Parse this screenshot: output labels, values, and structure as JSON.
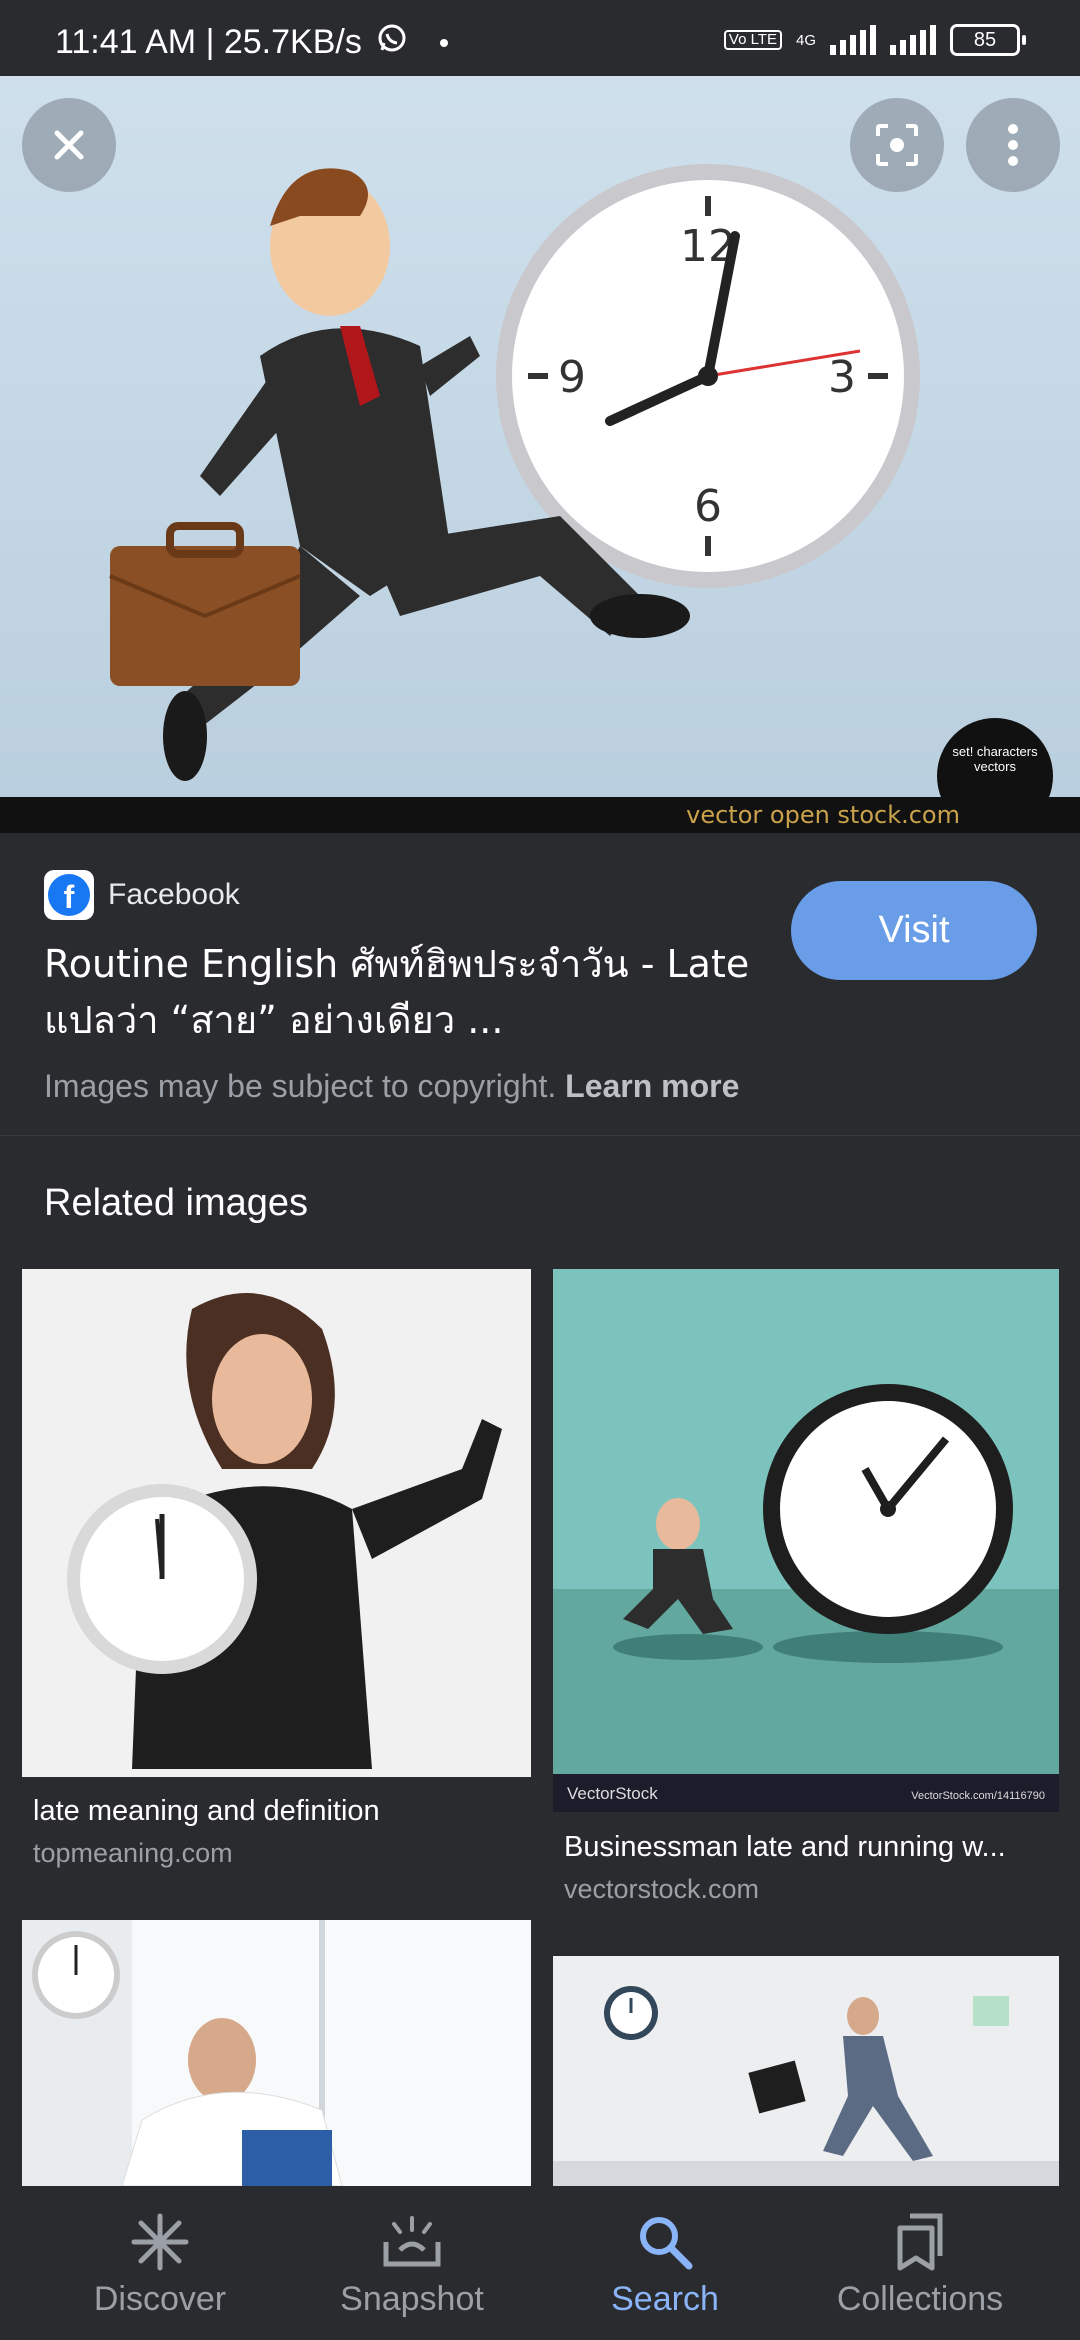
{
  "status_bar": {
    "time_speed": "11:41 AM | 25.7KB/s",
    "volte": "Vo LTE",
    "network": "4G",
    "battery": "85"
  },
  "hero": {
    "watermark": "vector open stock.com",
    "brand_badge": "set! characters vectors"
  },
  "result": {
    "source_name": "Facebook",
    "title": "Routine English ศัพท์ฮิพประจำวัน - Late แปลว่า “สาย” อย่างเดียว ...",
    "visit_label": "Visit",
    "copyright_text": "Images may be subject to copyright.",
    "learn_more": "Learn more"
  },
  "related": {
    "heading": "Related images",
    "cards": [
      {
        "title": "late meaning and definition",
        "domain": "topmeaning.com"
      },
      {
        "title": "Businessman late and running w...",
        "domain": "vectorstock.com",
        "watermark_left": "VectorStock",
        "watermark_right": "VectorStock.com/14116790"
      }
    ]
  },
  "bottom_nav": {
    "items": [
      {
        "label": "Discover",
        "icon": "asterisk-icon"
      },
      {
        "label": "Snapshot",
        "icon": "snapshot-icon"
      },
      {
        "label": "Search",
        "icon": "search-icon"
      },
      {
        "label": "Collections",
        "icon": "collections-icon"
      }
    ],
    "active": "Search"
  },
  "colors": {
    "background": "#2a2b2f",
    "accent": "#8ab4f8",
    "visit_button": "#6a9de8"
  }
}
